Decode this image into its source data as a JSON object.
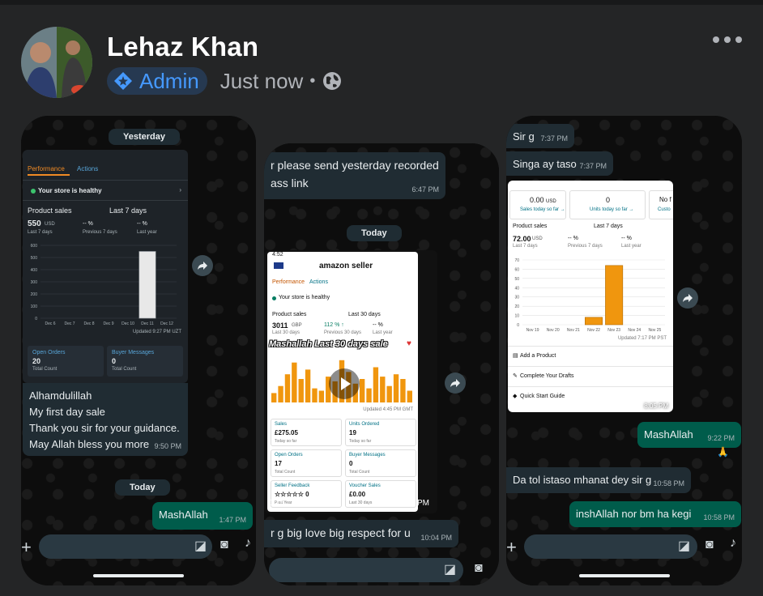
{
  "post": {
    "author": "Lehaz Khan",
    "badge": "Admin",
    "time": "Just now",
    "separator": "•",
    "icons": [
      "admin-star-icon",
      "globe-icon",
      "more-icon"
    ]
  },
  "shot1": {
    "date_top": "Yesterday",
    "tabs": [
      "Performance",
      "Actions"
    ],
    "health": "Your store is healthy",
    "product_sales_label": "Product sales",
    "range": "Last 7 days",
    "sales_value": "550",
    "sales_unit": "USD",
    "sales_caption": "Last 7 days",
    "prev_value": "-- %",
    "prev_caption": "Previous 7 days",
    "ly_value": "-- %",
    "ly_caption": "Last year",
    "y_ticks": [
      "600",
      "500",
      "400",
      "300",
      "200",
      "100",
      "0"
    ],
    "x_ticks": [
      "Dec 6",
      "Dec 7",
      "Dec 8",
      "Dec 9",
      "Dec 10",
      "Dec 11",
      "Dec 12"
    ],
    "updated": "Updated 9:27 PM UZT",
    "open_orders_label": "Open Orders",
    "open_orders_value": "20",
    "open_orders_sub": "Total Count",
    "buyer_msgs_label": "Buyer Messages",
    "buyer_msgs_value": "0",
    "buyer_msgs_sub": "Total Count",
    "message_lines": [
      "Alhamdulillah",
      "My first day sale",
      "Thank you sir for your guidance.",
      "May Allah bless you more"
    ],
    "message_time": "9:50 PM",
    "date_bottom": "Today",
    "reply": "MashAllah",
    "reply_time": "1:47 PM"
  },
  "shot2": {
    "msg_top_lines": [
      "r please send yesterday recorded",
      "ass link"
    ],
    "msg_top_time": "6:47 PM",
    "date": "Today",
    "status_time": "4:52",
    "brand": "amazon seller",
    "tabs": [
      "Performance",
      "Actions"
    ],
    "health": "Your store is healthy",
    "product_sales_label": "Product sales",
    "range": "Last 30 days",
    "sales_value": "3011",
    "sales_unit": "GBP",
    "sales_caption": "Last 30 days",
    "prev_value": "112 % ↑",
    "prev_caption": "Previous 30 days",
    "ly_value": "-- %",
    "ly_caption": "Last year",
    "overlay": "Mashallah Last 30 days sale",
    "updated": "Updated 4:45 PM GMT",
    "tiles": [
      {
        "label": "Sales",
        "value": "£275.05",
        "sub": "Today so far"
      },
      {
        "label": "Units Ordered",
        "value": "19",
        "sub": "Today so far"
      },
      {
        "label": "Open Orders",
        "value": "17",
        "sub": "Total Count"
      },
      {
        "label": "Buyer Messages",
        "value": "0",
        "sub": "Total Count"
      },
      {
        "label": "Seller Feedback",
        "value": "☆☆☆☆☆ 0",
        "sub": "Past Year"
      },
      {
        "label": "Voucher Sales",
        "value": "£0.00",
        "sub": "Last 30 days"
      }
    ],
    "video_duration": "0:15",
    "video_time": "10:04 PM",
    "msg_bottom": "r g big love big respect for u",
    "msg_bottom_time": "10:04 PM"
  },
  "shot3": {
    "msg1": "Sir g",
    "msg1_time": "7:37 PM",
    "msg2": "Singa ay taso",
    "msg2_time": "7:37 PM",
    "sales_today_value": "0.00",
    "sales_today_unit": "USD",
    "sales_today_link": "Sales today so far →",
    "units_today_value": "0",
    "units_today_link": "Units today so far →",
    "third_cut": "No f",
    "third_link": "Custo",
    "product_sales_label": "Product sales",
    "range": "Last 7 days",
    "sales_value": "72.00",
    "sales_unit": "USD",
    "sales_caption": "Last 7 days",
    "prev_value": "-- %",
    "prev_caption": "Previous 7 days",
    "ly_value": "-- %",
    "ly_caption": "Last year",
    "y_ticks": [
      "70",
      "60",
      "50",
      "40",
      "30",
      "20",
      "10",
      "0"
    ],
    "x_ticks": [
      "Nov 19",
      "Nov 20",
      "Nov 21",
      "Nov 22",
      "Nov 23",
      "Nov 24",
      "Nov 25"
    ],
    "updated": "Updated 7:17 PM PST",
    "links": [
      "Add a Product",
      "Complete Your Drafts",
      "Quick Start Guide"
    ],
    "img_time": "8:05 PM",
    "out1": "MashAllah",
    "out1_time": "9:22 PM",
    "reaction": "🙏",
    "in3": "Da tol istaso mhanat dey sir g",
    "in3_time": "10:58 PM",
    "out2": "inshAllah nor bm ha kegi",
    "out2_time": "10:58 PM"
  },
  "chart_data": [
    {
      "type": "bar",
      "title": "",
      "categories": [
        "Dec 6",
        "Dec 7",
        "Dec 8",
        "Dec 9",
        "Dec 10",
        "Dec 11",
        "Dec 12"
      ],
      "values": [
        0,
        0,
        0,
        0,
        0,
        550,
        0
      ],
      "ylim": [
        0,
        600
      ],
      "color": "#e8e8e8"
    },
    {
      "type": "bar",
      "title": "",
      "categories": [
        "Nov 19",
        "Nov 20",
        "Nov 21",
        "Nov 22",
        "Nov 23",
        "Nov 24",
        "Nov 25"
      ],
      "values": [
        0,
        0,
        0,
        8,
        64,
        0,
        0
      ],
      "ylim": [
        0,
        70
      ],
      "color": "#f0960e"
    }
  ]
}
